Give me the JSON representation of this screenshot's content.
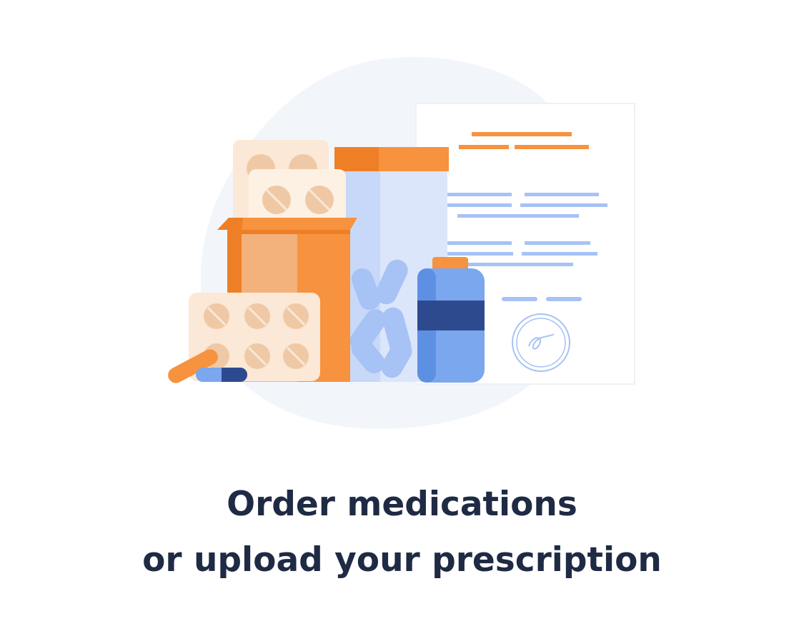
{
  "illustration": {
    "icons": [
      "pill-blister-icon",
      "pill-box-icon",
      "medicine-jar-icon",
      "medicine-bottle-icon",
      "capsule-icon",
      "prescription-document-icon",
      "stamp-icon"
    ],
    "colors": {
      "orange": "#f7923f",
      "orange_dark": "#ef7f27",
      "orange_light": "#f3b27b",
      "cream": "#fbe8d6",
      "pill_tan": "#efc9a6",
      "blue_light": "#dbe6fb",
      "blue_mid": "#a7c2f4",
      "blue": "#7aa7ee",
      "blue_dark": "#2e4a8e",
      "backdrop": "#f2f6fb"
    }
  },
  "headline": {
    "line1": "Order medications",
    "line2": "or upload your prescription"
  }
}
